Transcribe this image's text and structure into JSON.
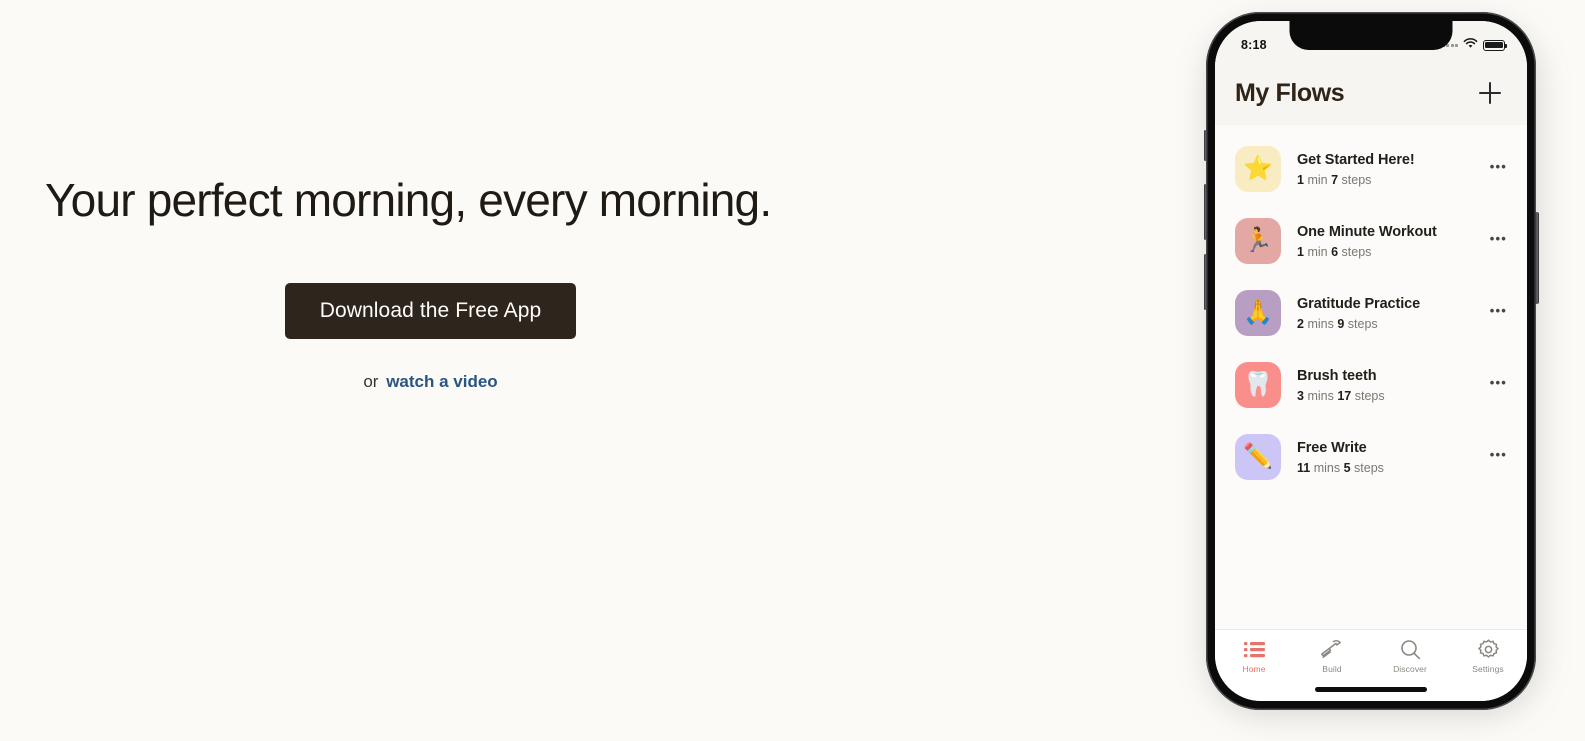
{
  "hero": {
    "headline": "Your perfect morning, every morning.",
    "cta_label": "Download the Free App",
    "subline_prefix": "or",
    "subline_link": "watch a video",
    "link_color": "#2B5580",
    "cta_bg": "#2E251C"
  },
  "phone": {
    "status": {
      "time": "8:18",
      "signal_icon": "signal-dots-icon",
      "wifi_icon": "wifi-icon",
      "battery_icon": "battery-icon"
    },
    "header": {
      "title": "My Flows",
      "add_icon": "plus-icon"
    },
    "flows": [
      {
        "name": "Get Started Here!",
        "duration": "1",
        "duration_unit": "min",
        "steps": "7",
        "steps_unit": "steps",
        "emoji": "⭐",
        "tile_color": "#FAECC2",
        "more_icon": "ellipsis-icon"
      },
      {
        "name": "One Minute Workout",
        "duration": "1",
        "duration_unit": "min",
        "steps": "6",
        "steps_unit": "steps",
        "emoji": "🏃",
        "tile_color": "#E3A7A4",
        "more_icon": "ellipsis-icon"
      },
      {
        "name": "Gratitude Practice",
        "duration": "2",
        "duration_unit": "mins",
        "steps": "9",
        "steps_unit": "steps",
        "emoji": "🙏",
        "tile_color": "#B89EC2",
        "more_icon": "ellipsis-icon"
      },
      {
        "name": "Brush teeth",
        "duration": "3",
        "duration_unit": "mins",
        "steps": "17",
        "steps_unit": "steps",
        "emoji": "🦷",
        "tile_color": "#F98E8B",
        "more_icon": "ellipsis-icon"
      },
      {
        "name": "Free Write",
        "duration": "11",
        "duration_unit": "mins",
        "steps": "5",
        "steps_unit": "steps",
        "emoji": "✏️",
        "tile_color": "#CBC6F5",
        "more_icon": "ellipsis-icon"
      }
    ],
    "tabs": [
      {
        "label": "Home",
        "icon": "list-icon",
        "active": true
      },
      {
        "label": "Build",
        "icon": "hammer-icon",
        "active": false
      },
      {
        "label": "Discover",
        "icon": "search-icon",
        "active": false
      },
      {
        "label": "Settings",
        "icon": "gear-icon",
        "active": false
      }
    ],
    "active_tab_color": "#E8736A",
    "inactive_tab_color": "#8C8781"
  }
}
